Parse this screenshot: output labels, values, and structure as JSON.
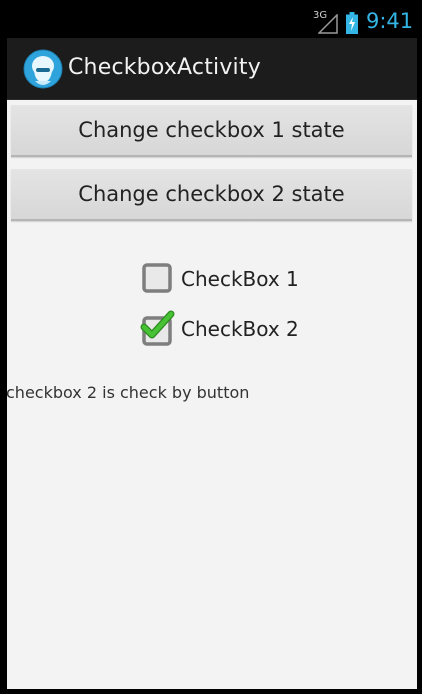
{
  "status_bar": {
    "network_type": "3G",
    "time": "9:41",
    "icons": [
      "signal-icon",
      "battery-icon"
    ]
  },
  "action_bar": {
    "icon": "app-launcher-icon",
    "title": "CheckboxActivity"
  },
  "buttons": {
    "change_cb1_label": "Change checkbox 1 state",
    "change_cb2_label": "Change checkbox 2 state"
  },
  "checkboxes": [
    {
      "label": "CheckBox 1",
      "checked": false
    },
    {
      "label": "CheckBox 2",
      "checked": true
    }
  ],
  "message": "checkbox 2 is check by button",
  "colors": {
    "accent_blue": "#33b5e5",
    "check_green": "#3fb62e",
    "content_bg": "#f3f3f3",
    "action_bar_bg": "#1c1c1c"
  }
}
